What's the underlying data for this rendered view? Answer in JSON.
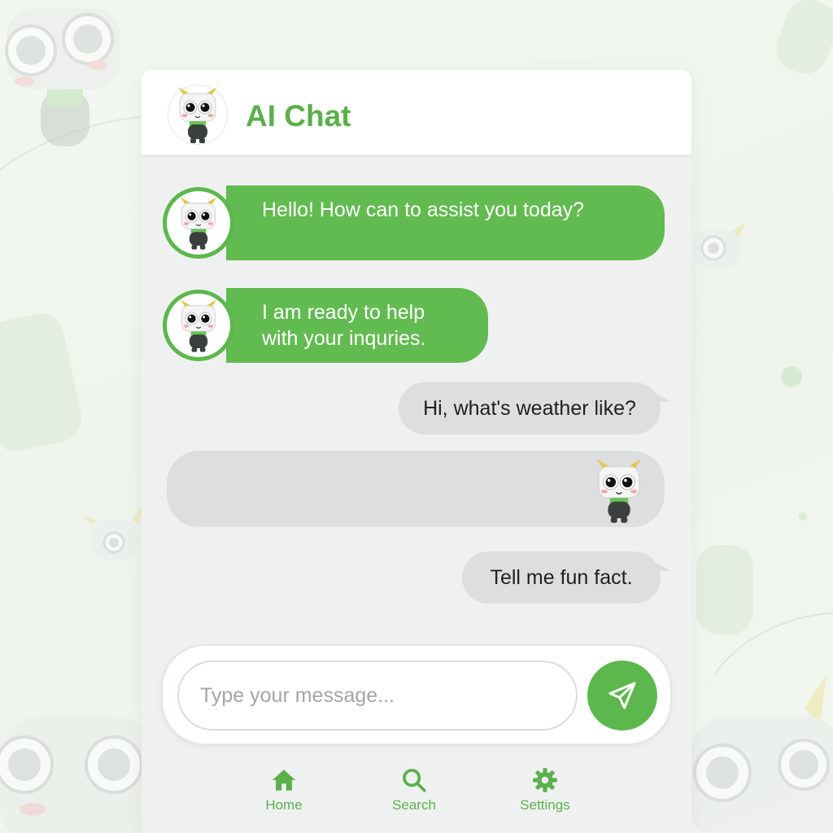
{
  "header": {
    "title": "AI Chat"
  },
  "messages": [
    {
      "from": "bot",
      "text": "Hello! How can to assist you today?"
    },
    {
      "from": "bot",
      "text": "I am ready to help with your inquries."
    },
    {
      "from": "user",
      "text": "Hi, what's weather like?"
    },
    {
      "from": "bot",
      "text": ""
    },
    {
      "from": "user",
      "text": "Tell me fun fact."
    }
  ],
  "composer": {
    "placeholder": "Type your message...",
    "value": ""
  },
  "nav": {
    "items": [
      {
        "label": "Home",
        "icon": "home-icon"
      },
      {
        "label": "Search",
        "icon": "search-icon"
      },
      {
        "label": "Settings",
        "icon": "gear-icon"
      }
    ]
  },
  "colors": {
    "accent": "#5cb84c",
    "user_bubble": "#dcdedf",
    "background": "#eff1f1"
  }
}
